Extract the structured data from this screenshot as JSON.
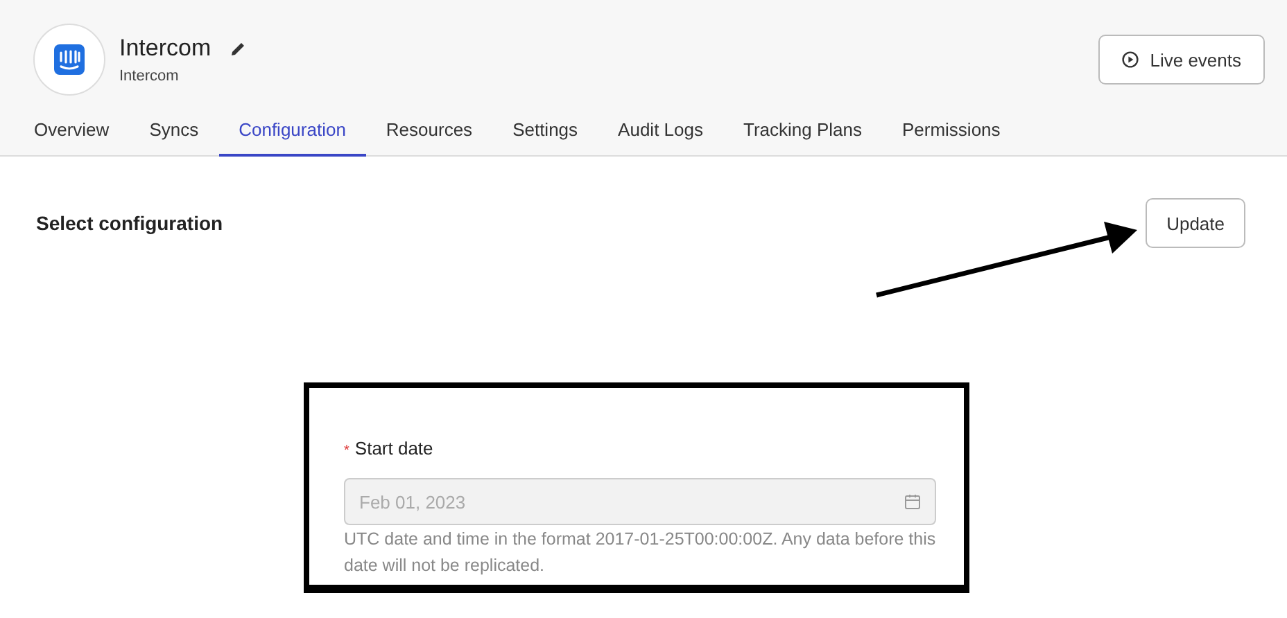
{
  "header": {
    "title": "Intercom",
    "subtitle": "Intercom",
    "live_button": "Live events"
  },
  "tabs": [
    {
      "label": "Overview",
      "selected": false
    },
    {
      "label": "Syncs",
      "selected": false
    },
    {
      "label": "Configuration",
      "selected": true
    },
    {
      "label": "Resources",
      "selected": false
    },
    {
      "label": "Settings",
      "selected": false
    },
    {
      "label": "Audit Logs",
      "selected": false
    },
    {
      "label": "Tracking Plans",
      "selected": false
    },
    {
      "label": "Permissions",
      "selected": false
    }
  ],
  "section": {
    "title": "Select configuration",
    "update_button": "Update"
  },
  "field": {
    "required_mark": "*",
    "label": "Start date",
    "value": "Feb 01, 2023",
    "disabled": true,
    "help": "UTC date and time in the format 2017-01-25T00:00:00Z. Any data before this date will not be replicated."
  }
}
